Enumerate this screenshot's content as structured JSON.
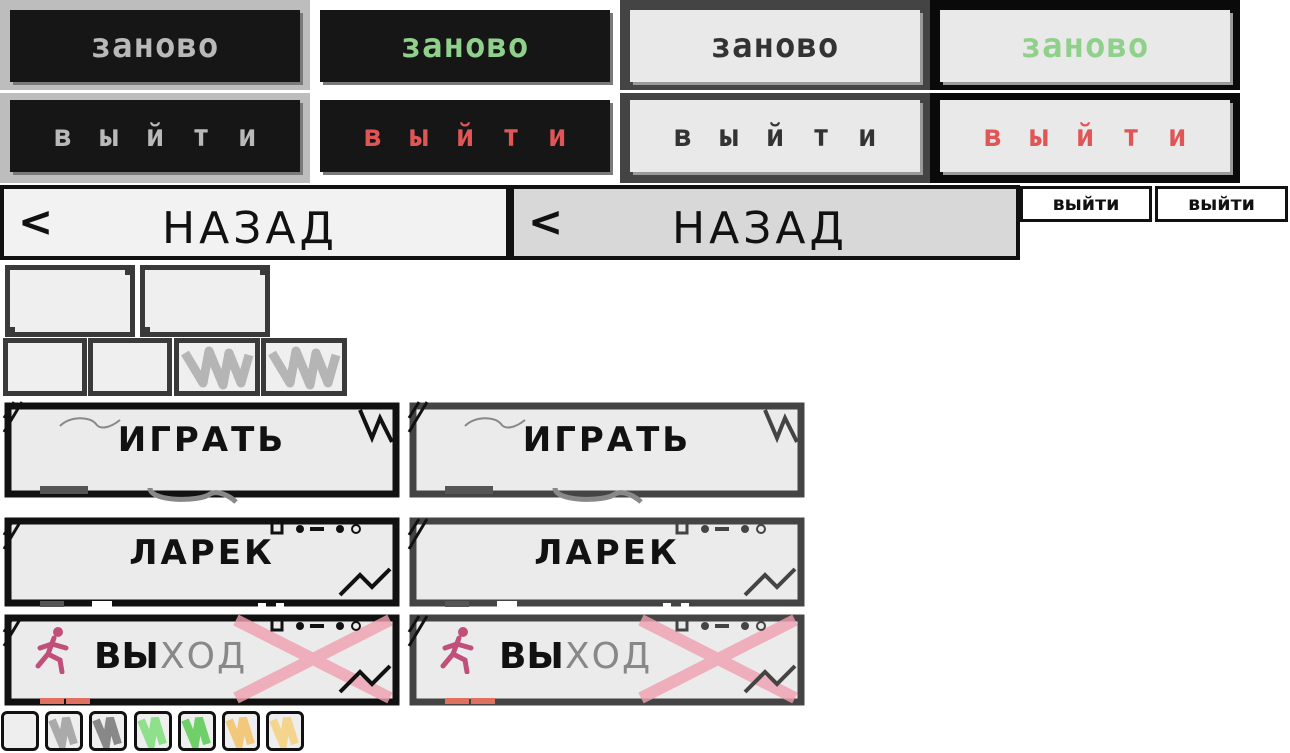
{
  "top_buttons": {
    "again_label": "заново",
    "exit_label": "выйти"
  },
  "back": {
    "chevron": "<",
    "label": "НАЗАД"
  },
  "mini_exit": {
    "label": "выйти"
  },
  "menu": {
    "play_label": "ИГРАТЬ",
    "shop_label": "ЛАРЕК",
    "exit_label_dark": "ВЫ",
    "exit_label_grey": "ХОД"
  },
  "colors": {
    "green_text": "#8fd18a",
    "red_text": "#e05656",
    "grey_text": "#b9b9b9",
    "dark_btn": "#161616",
    "light_btn": "#e9e9e9",
    "accent_pink": "#f0a0b0",
    "runner_pink": "#c0507a"
  },
  "icons": {
    "runner": "exit-runner-icon",
    "cross": "red-cross-icon"
  },
  "swatches": [
    "light",
    "grey",
    "grey-dark",
    "green",
    "green-dark",
    "yellow",
    "yellow-light"
  ]
}
